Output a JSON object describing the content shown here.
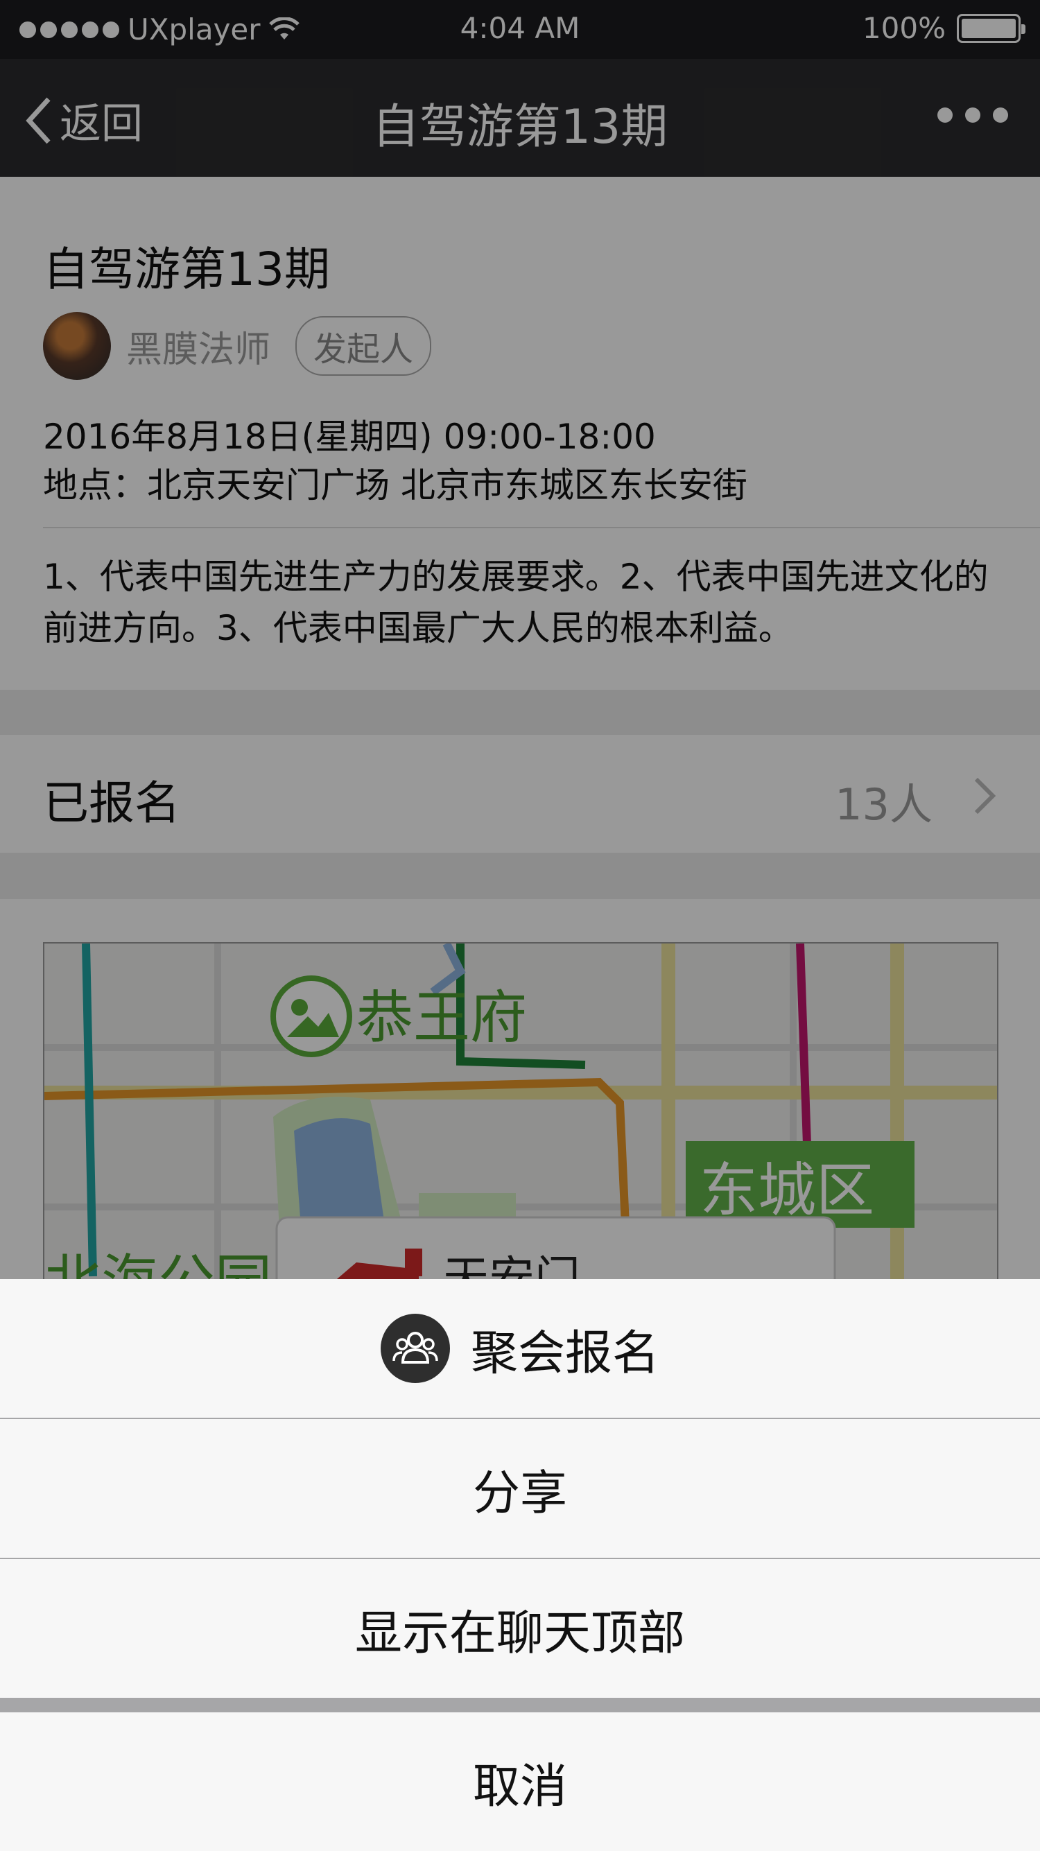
{
  "status_bar": {
    "carrier": "UXplayer",
    "time": "4:04 AM",
    "battery": "100%"
  },
  "nav": {
    "back_label": "返回",
    "title": "自驾游第13期"
  },
  "event": {
    "title": "自驾游第13期",
    "organizer_name": "黑膜法师",
    "organizer_badge": "发起人",
    "datetime": "2016年8月18日(星期四)  09:00-18:00",
    "location": "地点：北京天安门广场  北京市东城区东长安街",
    "description": "1、代表中国先进生产力的发展要求。2、代表中国先进文化的前进方向。3、代表中国最广大人民的根本利益。"
  },
  "signup": {
    "label": "已报名",
    "count": "13人"
  },
  "map": {
    "labels": {
      "gongwangfu": "恭王府",
      "dongcheng": "东城区",
      "beihai": "北海公园",
      "tiananmen": "天安门"
    }
  },
  "action_sheet": {
    "items": [
      "聚会报名",
      "分享",
      "显示在聊天顶部"
    ],
    "cancel": "取消"
  }
}
